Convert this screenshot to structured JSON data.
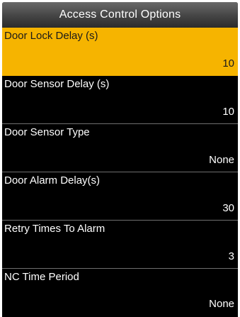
{
  "header": {
    "title": "Access Control Options"
  },
  "menu": {
    "items": [
      {
        "label": "Door Lock Delay (s)",
        "value": "10"
      },
      {
        "label": "Door Sensor Delay (s)",
        "value": "10"
      },
      {
        "label": "Door Sensor Type",
        "value": "None"
      },
      {
        "label": "Door Alarm Delay(s)",
        "value": "30"
      },
      {
        "label": "Retry Times To Alarm",
        "value": "3"
      },
      {
        "label": "NC Time Period",
        "value": "None"
      }
    ],
    "selected_index": 0
  },
  "colors": {
    "highlight": "#f6b400",
    "background": "#000000",
    "text": "#ffffff"
  }
}
